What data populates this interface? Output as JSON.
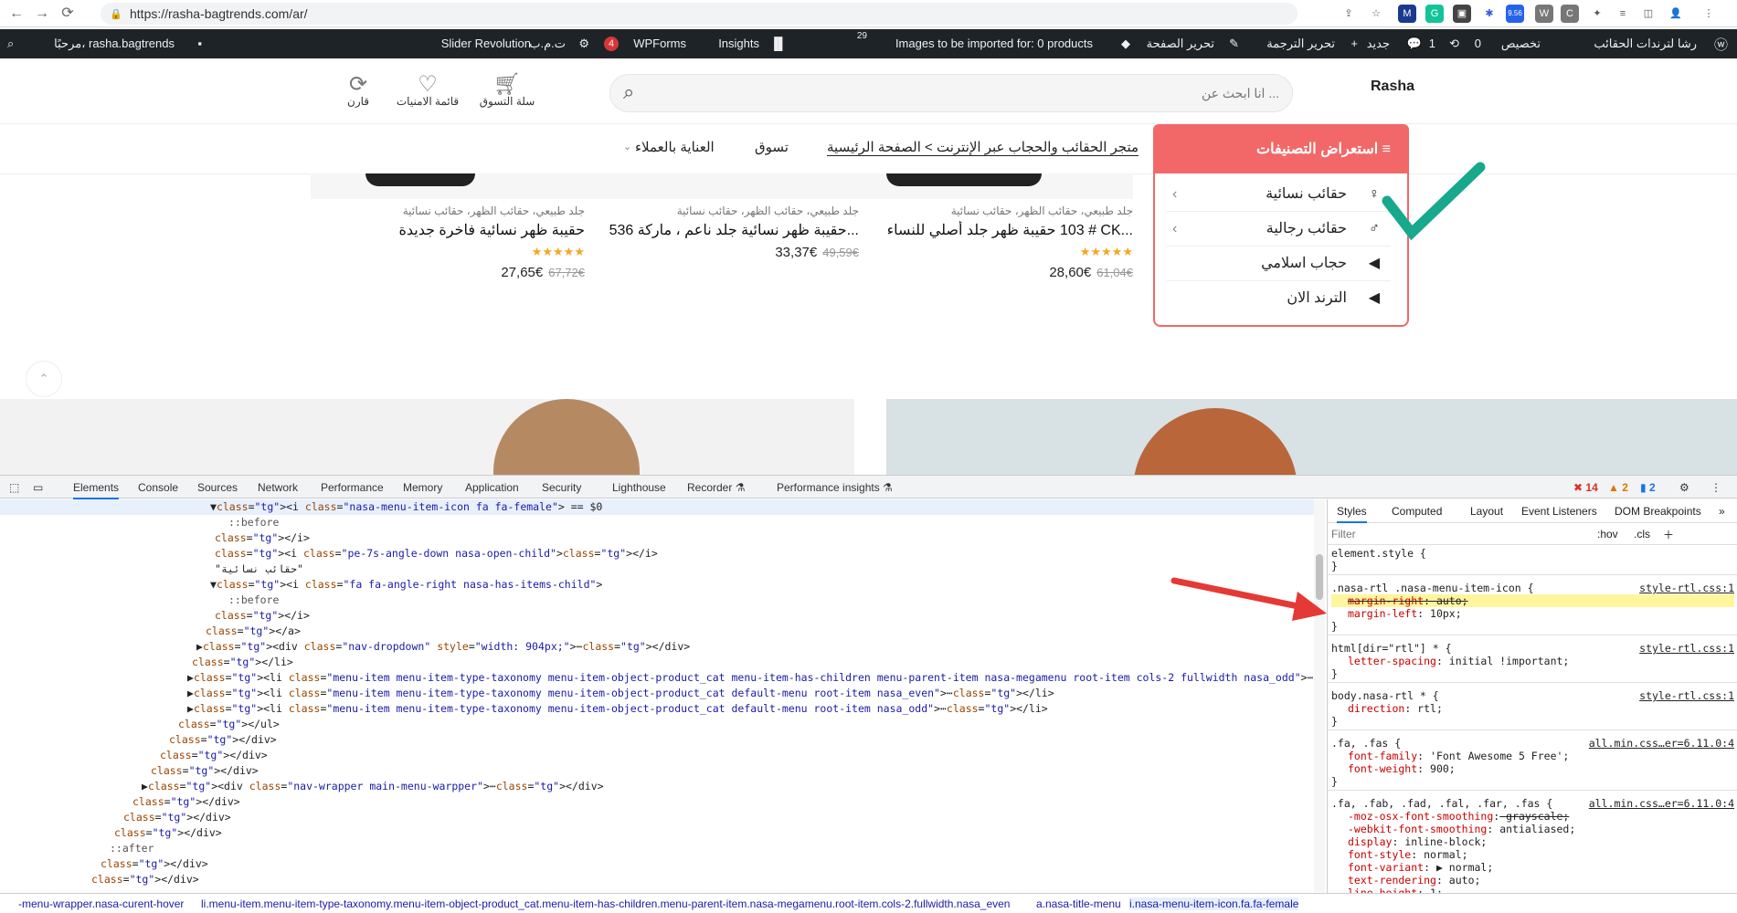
{
  "browser": {
    "url": "https://rasha-bagtrends.com/ar/",
    "back": "←",
    "forward": "→",
    "reload": "⟳"
  },
  "extensions": [
    "M",
    "G",
    "▣",
    "✱",
    "9.56",
    "W",
    "C",
    "✦",
    "≡",
    "◫",
    "👤",
    "⋮"
  ],
  "adminbar": {
    "site": "رشا لترندات الحقائب",
    "customize": "تخصيص",
    "updates": "0",
    "comments": "1",
    "new": "جديد",
    "edit_translation": "تحرير الترجمة",
    "edit_page": "تحرير الصفحة",
    "import": "Images to be imported for: 0 products",
    "counter": "29",
    "insights": "Insights",
    "wpforms": "WPForms",
    "wpforms_count": "4",
    "currency": "ت.م.ب",
    "slider": "Slider Revolution",
    "greeting": "مرحبًا، rasha.bagtrends"
  },
  "header": {
    "logo": "Rasha",
    "search_placeholder": "انا ابحث عن ...",
    "cart": "سلة التسوق",
    "wishlist": "قائمة الامنيات",
    "compare": "قارن"
  },
  "nav": {
    "categories_title": "استعراض التصنيفات",
    "breadcrumb": "متجر الحقائب والحجاب عبر الإنترنت > الصفحة الرئيسية",
    "shop": "تسوق",
    "beauty": "العناية بالعملاء"
  },
  "categories": [
    {
      "label": "حقائب نسائية",
      "icon": "female-icon"
    },
    {
      "label": "حقائب رجالية",
      "icon": "male-icon"
    },
    {
      "label": "حجاب اسلامي",
      "icon": "caret-icon"
    },
    {
      "label": "الترند الان",
      "icon": "caret-icon"
    }
  ],
  "products": [
    {
      "cats": "جلد طبيعي، حقائب الظهر، حقائب نسائية",
      "title": "حقيبة ظهر جلد أصلي للنساء ‎103 # CK...",
      "price": "28,60€",
      "old": "61,04€",
      "stars": "★★★★★"
    },
    {
      "cats": "جلد طبيعي، حقائب الظهر، حقائب نسائية",
      "title": "حقيبة ظهر نسائية جلد ناعم ، ماركة 536...",
      "price": "33,37€",
      "old": "49,59€",
      "stars": ""
    },
    {
      "cats": "جلد طبيعي، حقائب الظهر، حقائب نسائية",
      "title": "حقيبة ظهر نسائية فاخرة جديدة",
      "price": "27,65€",
      "old": "67,72€",
      "stars": "★★★★★"
    }
  ],
  "devtools": {
    "tabs": [
      "Elements",
      "Console",
      "Sources",
      "Network",
      "Performance",
      "Memory",
      "Application",
      "Security",
      "Lighthouse",
      "Recorder ⚗",
      "Performance insights ⚗"
    ],
    "errors": "14",
    "warnings": "2",
    "info": "2",
    "style_tabs": [
      "Styles",
      "Computed",
      "Layout",
      "Event Listeners",
      "DOM Breakpoints"
    ],
    "filter": "Filter",
    "hov": ":hov",
    ".cls": ".cls"
  },
  "dom_lines": [
    "▼<i class=\"nasa-menu-item-icon fa fa-female\"> == $0",
    "::before",
    "</i>",
    "<i class=\"pe-7s-angle-down nasa-open-child\"></i>",
    "\"حقائب نسائية\"",
    "▼<i class=\"fa fa-angle-right nasa-has-items-child\">",
    "::before",
    "</i>",
    "</a>",
    "▶<div class=\"nav-dropdown\" style=\"width: 904px;\">⋯</div>",
    "</li>",
    "▶<li class=\"menu-item menu-item-type-taxonomy menu-item-object-product_cat menu-item-has-children menu-parent-item nasa-megamenu root-item cols-2 fullwidth nasa_odd\">⋯</li>",
    "▶<li class=\"menu-item menu-item-type-taxonomy menu-item-object-product_cat default-menu root-item nasa_even\">⋯</li>",
    "▶<li class=\"menu-item menu-item-type-taxonomy menu-item-object-product_cat default-menu root-item nasa_odd\">⋯</li>",
    "</ul>",
    "</div>",
    "</div>",
    "</div>",
    "▶<div class=\"nav-wrapper main-menu-warpper\">⋯</div>",
    "</div>",
    "</div>",
    "</div>",
    "::after",
    "</div>",
    "</div>"
  ],
  "styles": [
    {
      "sel": "element.style {",
      "src": "",
      "props": []
    },
    {
      "sel": ".nasa-rtl .nasa-menu-item-icon {",
      "src": "style-rtl.css:1",
      "props": [
        "margin-right: auto;",
        "margin-left: 10px;"
      ]
    },
    {
      "sel": "html[dir=\"rtl\"] * {",
      "src": "style-rtl.css:1",
      "props": [
        "letter-spacing: initial !important;"
      ]
    },
    {
      "sel": "body.nasa-rtl * {",
      "src": "style-rtl.css:1",
      "props": [
        "direction: rtl;"
      ]
    },
    {
      "sel": ".fa, .fas {",
      "src": "all.min.css…er=6.11.0:4",
      "props": [
        "font-family: 'Font Awesome 5 Free';",
        "font-weight: 900;"
      ]
    },
    {
      "sel": ".fa, .fab, .fad, .fal, .far, .fas {",
      "src": "all.min.css…er=6.11.0:4",
      "props": [
        "-moz-osx-font-smoothing: grayscale;",
        "-webkit-font-smoothing: antialiased;",
        "display: inline-block;",
        "font-style: normal;",
        "font-variant: ▶ normal;",
        "text-rendering: auto;",
        "line-height: 1;"
      ]
    }
  ],
  "crumbs": [
    "-menu-wrapper.nasa-curent-hover",
    "li.menu-item.menu-item-type-taxonomy.menu-item-object-product_cat.menu-item-has-children.menu-parent-item.nasa-megamenu.root-item.cols-2.fullwidth.nasa_even",
    "a.nasa-title-menu",
    "i.nasa-menu-item-icon.fa.fa-female"
  ]
}
